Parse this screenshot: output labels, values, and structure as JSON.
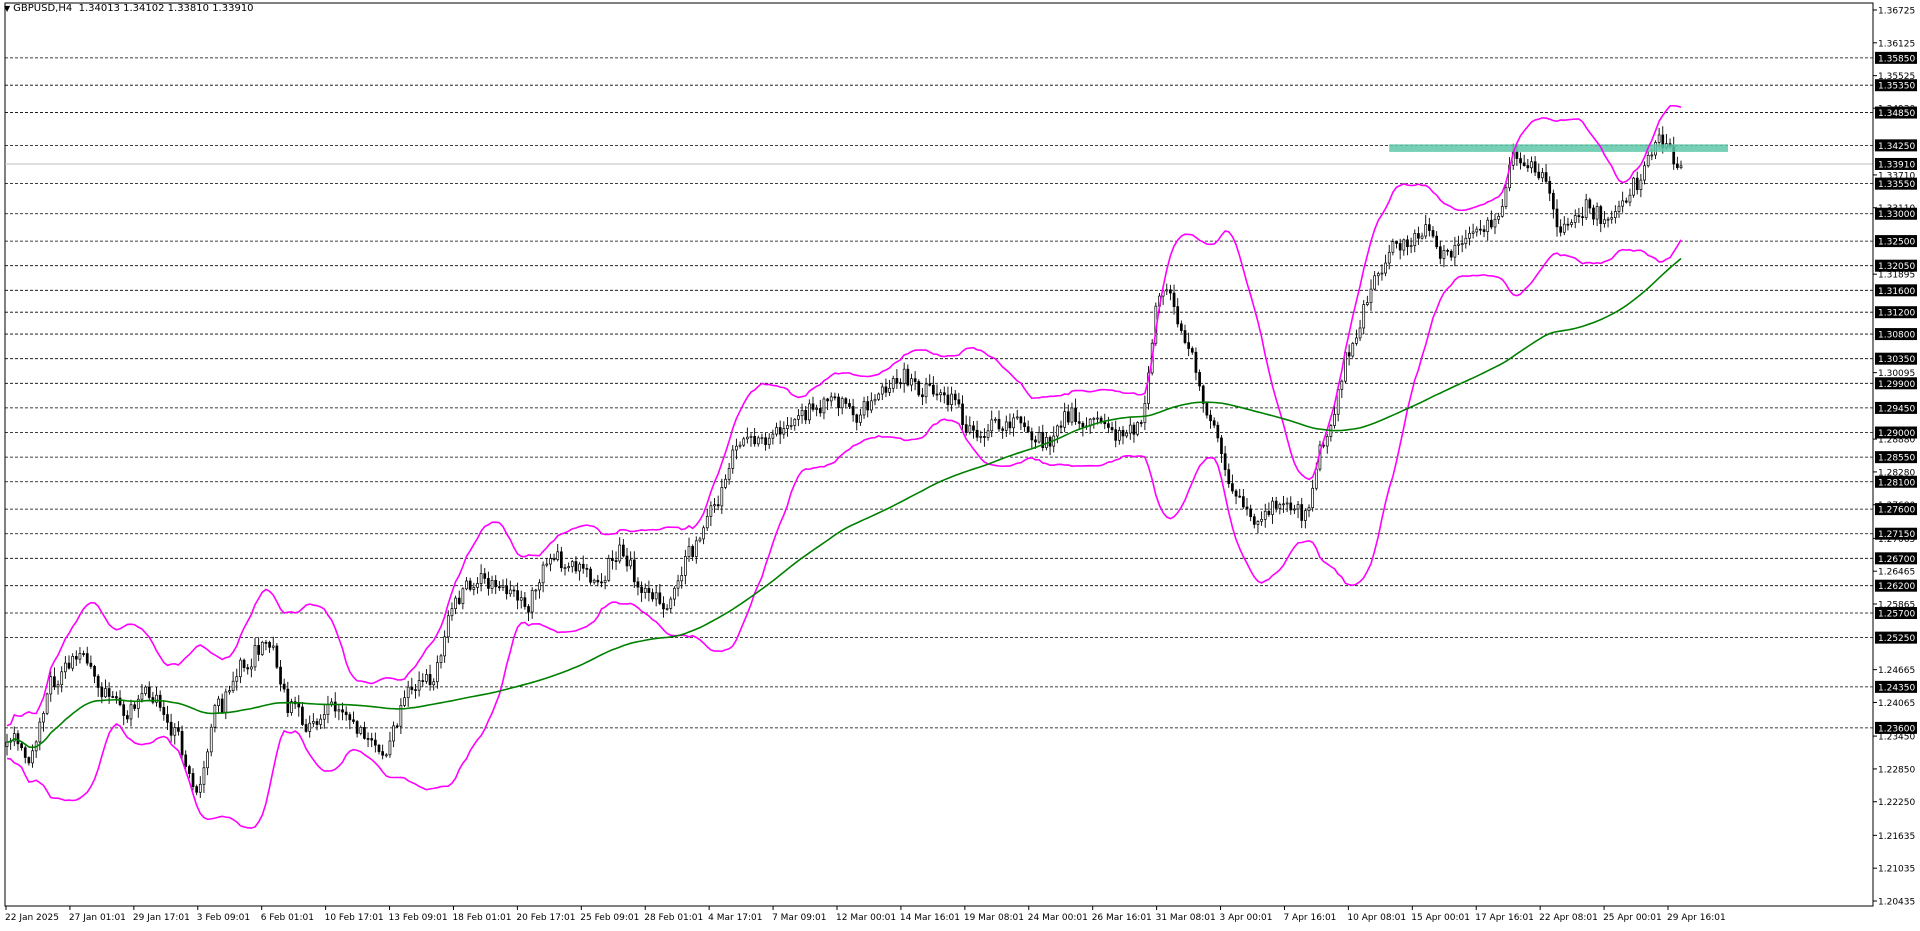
{
  "header": {
    "symbol": "GBPUSD,H4",
    "ohlc": "1.34013 1.34102 1.33810 1.33910",
    "menu_icon": "triangle-down-icon"
  },
  "colors": {
    "background": "#ffffff",
    "candle": "#000000",
    "bollinger": "#ff00ff",
    "moving_average": "#008000",
    "zone": "#5fc8a8",
    "level_line": "#000000",
    "current_price_line": "#c0c0c0",
    "label_bg": "#000000",
    "label_text": "#ffffff"
  },
  "chart_data": {
    "type": "candlestick",
    "title": "",
    "xlabel": "",
    "ylabel": "",
    "ylim": [
      1.20435,
      1.36725
    ],
    "grid": false,
    "x_tick_labels": [
      "22 Jan 2025",
      "27 Jan 01:01",
      "29 Jan 17:01",
      "3 Feb 09:01",
      "6 Feb 01:01",
      "10 Feb 17:01",
      "13 Feb 09:01",
      "18 Feb 01:01",
      "20 Feb 17:01",
      "25 Feb 09:01",
      "28 Feb 01:01",
      "4 Mar 17:01",
      "7 Mar 09:01",
      "12 Mar 00:01",
      "14 Mar 16:01",
      "19 Mar 08:01",
      "24 Mar 00:01",
      "26 Mar 16:01",
      "31 Mar 08:01",
      "3 Apr 00:01",
      "7 Apr 16:01",
      "10 Apr 08:01",
      "15 Apr 00:01",
      "17 Apr 16:01",
      "22 Apr 08:01",
      "25 Apr 00:01",
      "29 Apr 16:01"
    ],
    "y_tick_labels": [
      "1.36725",
      "1.36125",
      "1.35525",
      "1.34930",
      "1.33710",
      "1.33110",
      "1.31895",
      "1.30095",
      "1.28880",
      "1.28280",
      "1.27680",
      "1.27065",
      "1.26465",
      "1.25865",
      "1.24665",
      "1.24065",
      "1.23450",
      "1.22850",
      "1.22250",
      "1.21635",
      "1.21035",
      "1.20435"
    ],
    "horizontal_levels": [
      "1.35850",
      "1.35350",
      "1.34850",
      "1.34250",
      "1.33550",
      "1.33000",
      "1.32500",
      "1.32050",
      "1.31600",
      "1.31200",
      "1.30800",
      "1.30350",
      "1.29900",
      "1.29450",
      "1.29000",
      "1.28550",
      "1.28100",
      "1.27600",
      "1.27150",
      "1.26700",
      "1.26200",
      "1.25700",
      "1.25250",
      "1.24350",
      "1.23600"
    ],
    "current_price": "1.33910",
    "zone": {
      "from": 1.3413,
      "to": 1.3427
    },
    "path_anchors": [
      1.235,
      1.231,
      1.245,
      1.25,
      1.243,
      1.239,
      1.242,
      1.236,
      1.225,
      1.24,
      1.247,
      1.252,
      1.24,
      1.236,
      1.24,
      1.235,
      1.232,
      1.242,
      1.245,
      1.26,
      1.263,
      1.262,
      1.258,
      1.267,
      1.266,
      1.263,
      1.268,
      1.262,
      1.258,
      1.268,
      1.276,
      1.287,
      1.289,
      1.29,
      1.294,
      1.296,
      1.293,
      1.297,
      1.3,
      1.298,
      1.296,
      1.29,
      1.291,
      1.292,
      1.288,
      1.293,
      1.292,
      1.29,
      1.291,
      1.317,
      1.307,
      1.293,
      1.28,
      1.273,
      1.277,
      1.275,
      1.29,
      1.305,
      1.318,
      1.324,
      1.327,
      1.323,
      1.326,
      1.328,
      1.341,
      1.338,
      1.327,
      1.331,
      1.329,
      1.335,
      1.343,
      1.339
    ],
    "ohlc": [],
    "series": [
      {
        "name": "",
        "type": "line",
        "role": "moving-average",
        "color": "#008000"
      },
      {
        "name": "",
        "type": "line",
        "role": "bollinger-upper",
        "color": "#ff00ff"
      },
      {
        "name": "",
        "type": "line",
        "role": "bollinger-lower",
        "color": "#ff00ff"
      }
    ]
  }
}
